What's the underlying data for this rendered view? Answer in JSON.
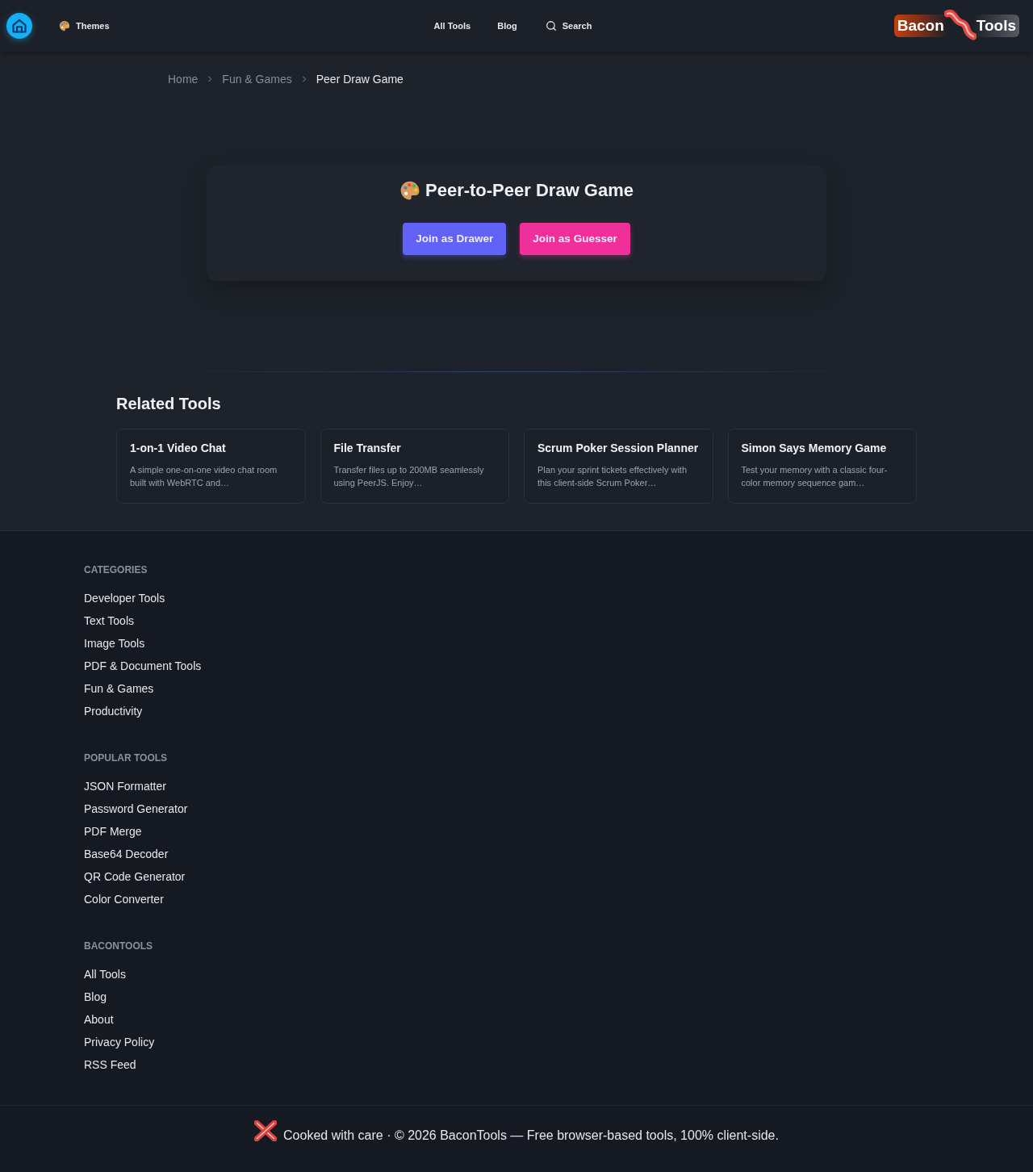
{
  "header": {
    "theme_button": {
      "label": "Themes"
    },
    "nav": [
      {
        "label": "All Tools"
      },
      {
        "label": "Blog"
      }
    ],
    "search": {
      "label": "Search"
    },
    "logo": {
      "words": [
        "Bacon",
        "Tools"
      ]
    }
  },
  "breadcrumb": [
    {
      "label": "Home",
      "current": false
    },
    {
      "label": "Fun & Games",
      "current": false
    },
    {
      "label": "Peer Draw Game",
      "current": true
    }
  ],
  "game": {
    "title": "Peer-to-Peer Draw Game",
    "buttons": [
      {
        "label": "Join as Drawer",
        "kind": "drawer"
      },
      {
        "label": "Join as Guesser",
        "kind": "guesser"
      }
    ]
  },
  "related": {
    "title": "Related Tools",
    "cards": [
      {
        "title": "1-on-1 Video Chat",
        "description": "A simple one-on-one video chat room built with WebRTC and…"
      },
      {
        "title": "File Transfer",
        "description": "Transfer files up to 200MB seamlessly using PeerJS. Enjoy…"
      },
      {
        "title": "Scrum Poker Session Planner",
        "description": "Plan your sprint tickets effectively with this client-side Scrum Poker…"
      },
      {
        "title": "Simon Says Memory Game",
        "description": "Test your memory with a classic four-color memory sequence gam…"
      }
    ]
  },
  "footer": {
    "sections": [
      {
        "heading": "CATEGORIES",
        "links": [
          "Developer Tools",
          "Text Tools",
          "Image Tools",
          "PDF & Document Tools",
          "Fun & Games",
          "Productivity"
        ]
      },
      {
        "heading": "POPULAR TOOLS",
        "links": [
          "JSON Formatter",
          "Password Generator",
          "PDF Merge",
          "Base64 Decoder",
          "QR Code Generator",
          "Color Converter"
        ]
      },
      {
        "heading": "BACONTOOLS",
        "links": [
          "All Tools",
          "Blog",
          "About",
          "Privacy Policy",
          "RSS Feed"
        ]
      }
    ],
    "credit": "Cooked with care · © 2026 BaconTools — Free browser-based tools, 100% client-side."
  }
}
